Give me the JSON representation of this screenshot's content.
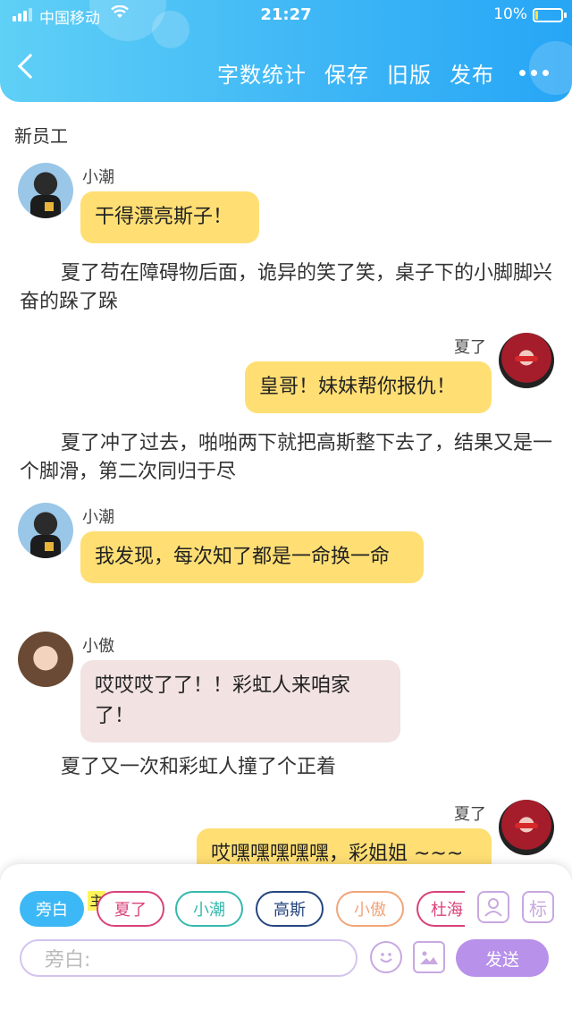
{
  "status": {
    "carrier": "中国移动",
    "time": "21:27",
    "battery": "10%",
    "battery_level": 0.1
  },
  "header": {
    "actions": [
      "字数统计",
      "保存",
      "旧版",
      "发布"
    ]
  },
  "scene_label": "新员工",
  "messages": [
    {
      "kind": "left",
      "name": "小潮",
      "text": "干得漂亮斯子！",
      "bubble": "yellow"
    },
    {
      "kind": "narration",
      "text": "夏了苟在障碍物后面，诡异的笑了笑，桌子下的小脚脚兴奋的跺了跺"
    },
    {
      "kind": "right",
      "name": "夏了",
      "text": "皇哥！妹妹帮你报仇！",
      "bubble": "yellow"
    },
    {
      "kind": "narration",
      "text": "夏了冲了过去，啪啪两下就把高斯整下去了，结果又是一个脚滑，第二次同归于尽"
    },
    {
      "kind": "left",
      "name": "小潮",
      "text": "我发现，每次知了都是一命换一命",
      "bubble": "yellow"
    },
    {
      "kind": "left",
      "name": "小傲",
      "text": "哎哎哎了了！！彩虹人来咱家了！",
      "bubble": "pink"
    },
    {
      "kind": "narration",
      "text": "夏了又一次和彩虹人撞了个正着"
    },
    {
      "kind": "right",
      "name": "夏了",
      "text": "哎嘿嘿嘿嘿嘿，彩姐姐 ~~~",
      "bubble": "yellow"
    }
  ],
  "composer": {
    "roles": [
      {
        "label": "旁白",
        "color": "#3db8f6",
        "active": true
      },
      {
        "label": "夏了",
        "color": "#d9427a",
        "active": false
      },
      {
        "label": "小潮",
        "color": "#35b9ad",
        "active": false
      },
      {
        "label": "高斯",
        "color": "#25467f",
        "active": false
      },
      {
        "label": "小傲",
        "color": "#f0a57a",
        "active": false
      },
      {
        "label": "杜海",
        "color": "#d9427a",
        "active": false
      }
    ],
    "host_badge": "主",
    "tag_label": "标",
    "placeholder": "旁白:",
    "send_label": "发送"
  }
}
